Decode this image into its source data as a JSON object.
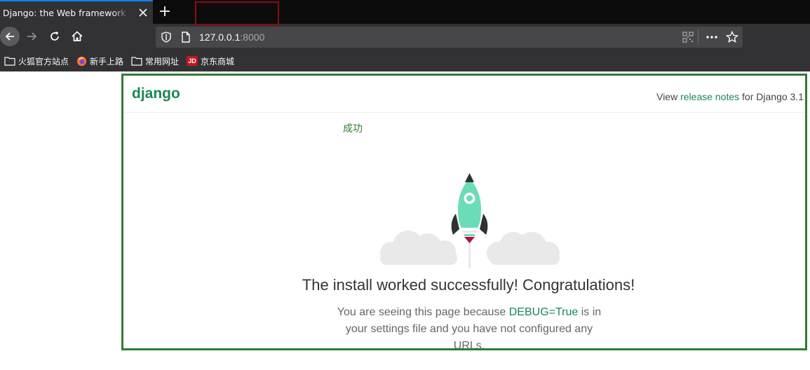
{
  "browser": {
    "tab_title": "Django: the Web framework for perfectionists with deadlines.",
    "url_host": "127.0.0.1",
    "url_port": ":8000",
    "bookmarks": [
      {
        "label": "火狐官方站点",
        "icon": "folder-icon"
      },
      {
        "label": "新手上路",
        "icon": "firefox-icon"
      },
      {
        "label": "常用网址",
        "icon": "folder-icon"
      },
      {
        "label": "京东商城",
        "icon": "jd-icon",
        "badge": "JD"
      }
    ],
    "colors": {
      "chrome": "#323234",
      "tabbar": "#0c0c0d",
      "accent": "#0a84ff"
    }
  },
  "page": {
    "logo": "django",
    "release_prefix": "View ",
    "release_link": "release notes",
    "release_suffix": " for Django 3.1",
    "success_label": "成功",
    "headline": "The install worked successfully! Congratulations!",
    "body_prefix": "You are seeing this page because ",
    "body_debug": "DEBUG=True",
    "body_suffix": " is in your settings file and you have not configured any URLs.",
    "colors": {
      "brand": "#198754",
      "frame": "#2e7d32",
      "rocket": "#6bdcb8"
    }
  }
}
